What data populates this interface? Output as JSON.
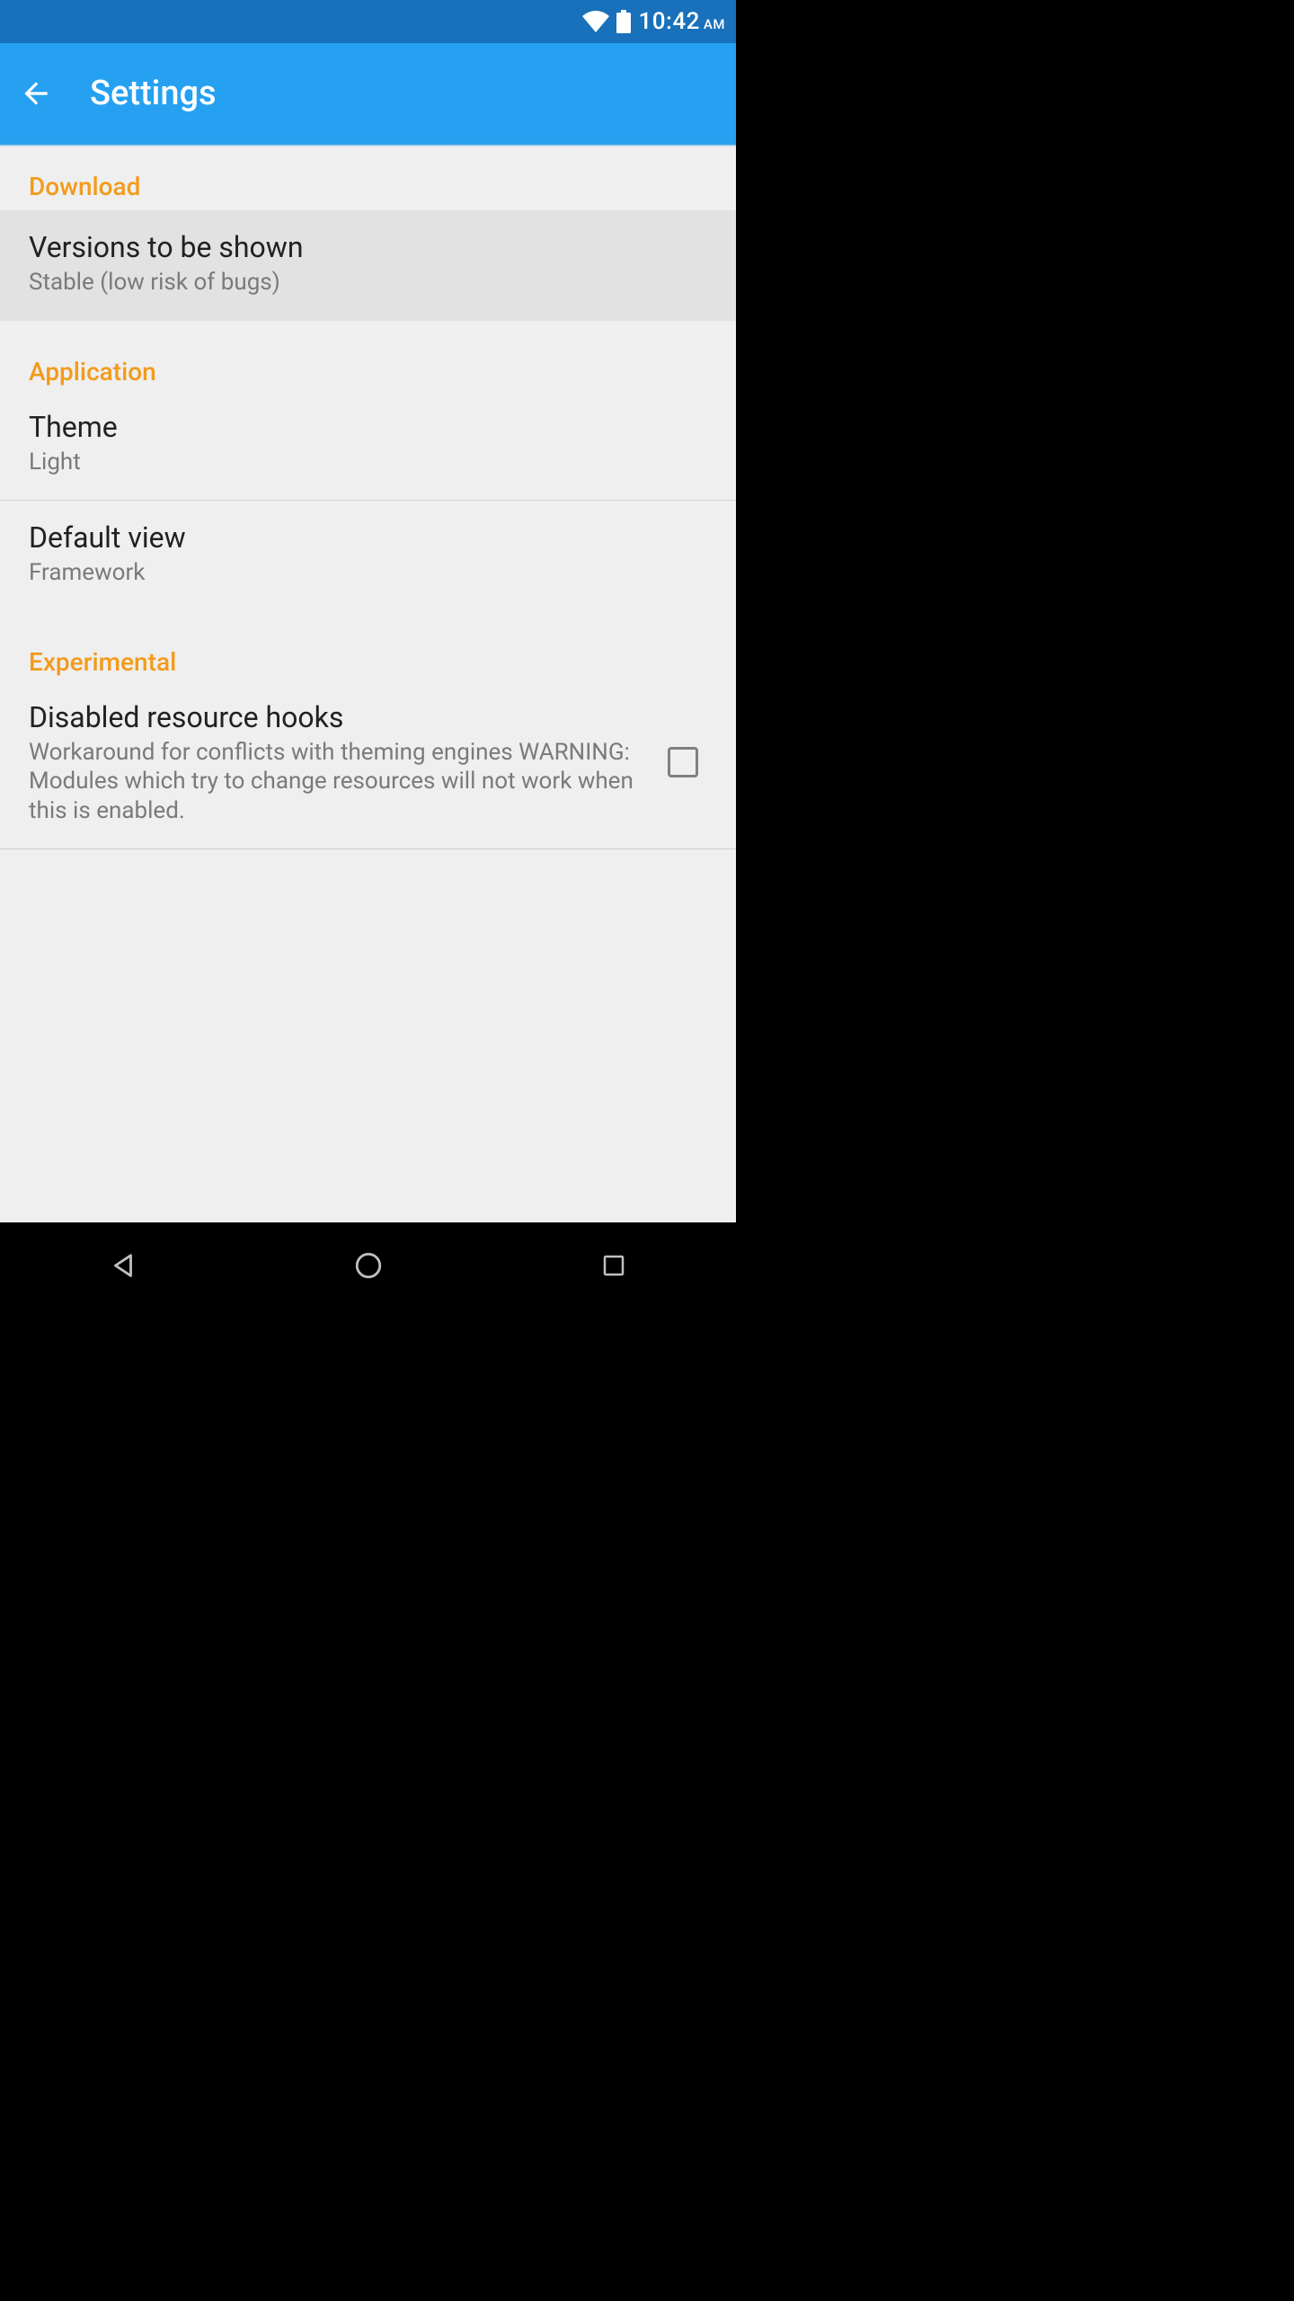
{
  "status": {
    "time": "10:42",
    "ampm": "AM"
  },
  "appbar": {
    "title": "Settings"
  },
  "sections": {
    "download": {
      "header": "Download",
      "versions": {
        "title": "Versions to be shown",
        "sub": "Stable (low risk of bugs)"
      }
    },
    "application": {
      "header": "Application",
      "theme": {
        "title": "Theme",
        "sub": "Light"
      },
      "default_view": {
        "title": "Default view",
        "sub": "Framework"
      }
    },
    "experimental": {
      "header": "Experimental",
      "hooks": {
        "title": "Disabled resource hooks",
        "sub": "Workaround for conflicts with theming engines WARNING: Modules which try to change resources will not work when this is enabled.",
        "checked": false
      }
    }
  }
}
